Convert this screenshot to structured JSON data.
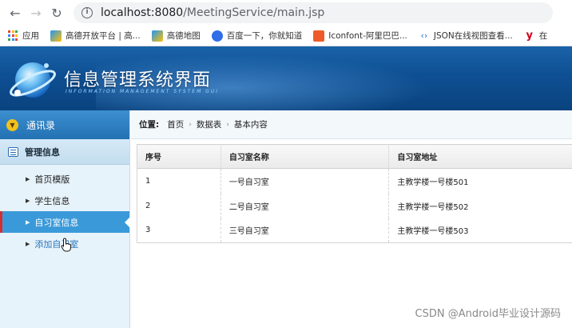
{
  "browser": {
    "url_host": "localhost:8080",
    "url_path": "/MeetingService/main.jsp",
    "bookmarks": [
      {
        "label": "应用",
        "icon": "apps-grid-icon"
      },
      {
        "label": "高德开放平台 | 高...",
        "icon": "amap-icon"
      },
      {
        "label": "高德地图",
        "icon": "amap-icon"
      },
      {
        "label": "百度一下，你就知道",
        "icon": "baidu-paw-icon"
      },
      {
        "label": "Iconfont-阿里巴巴...",
        "icon": "iconfont-icon"
      },
      {
        "label": "JSON在线视图查看...",
        "icon": "json-icon"
      },
      {
        "label": "在",
        "icon": "yahoo-icon"
      }
    ]
  },
  "header": {
    "title": "信息管理系统界面",
    "subtitle": "INFORMATION MANAGEMENT SYSTEM GUI"
  },
  "sidebar": {
    "group1": "通讯录",
    "group2": "管理信息",
    "items": [
      {
        "label": "首页模版"
      },
      {
        "label": "学生信息"
      },
      {
        "label": "自习室信息"
      },
      {
        "label": "添加自习室"
      }
    ]
  },
  "breadcrumb": {
    "label": "位置:",
    "items": [
      "首页",
      "数据表",
      "基本内容"
    ]
  },
  "table": {
    "headers": [
      "序号",
      "自习室名称",
      "自习室地址"
    ],
    "rows": [
      [
        "1",
        "一号自习室",
        "主教学楼一号楼501"
      ],
      [
        "2",
        "二号自习室",
        "主教学楼一号楼502"
      ],
      [
        "3",
        "三号自习室",
        "主教学楼一号楼503"
      ]
    ]
  },
  "watermark": "CSDN @Android毕业设计源码"
}
